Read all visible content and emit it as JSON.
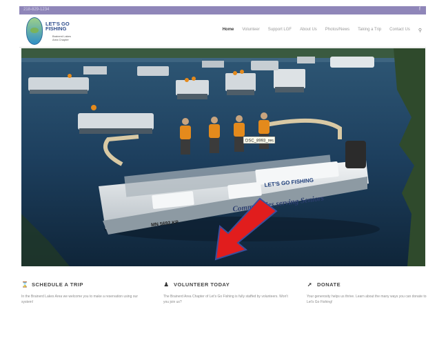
{
  "topbar": {
    "phone": "218-829-1234",
    "social_icon": "facebook-icon"
  },
  "logo": {
    "line1": "LET'S GO",
    "line2": "FISHING",
    "line3": "Brainerd Lakes",
    "line4": "Area Chapter"
  },
  "nav": {
    "items": [
      {
        "label": "Home",
        "active": true
      },
      {
        "label": "Volunteer"
      },
      {
        "label": "Support LGF"
      },
      {
        "label": "About Us"
      },
      {
        "label": "Photos/News"
      },
      {
        "label": "Taking a Trip"
      },
      {
        "label": "Contact Us"
      }
    ],
    "search_icon": "search-icon"
  },
  "hero": {
    "tooltip": "DSC_8993_res",
    "boat_banner": "Communities serving Seniors",
    "boat_brand": "LET'S GO FISHING",
    "boat_reg": "MN 5692 KP",
    "colors": {
      "water": "#1d3f5e",
      "boat_white": "#e9ecee",
      "vest": "#e48a1c",
      "arrow": "#e11d1d"
    }
  },
  "features": [
    {
      "icon": "hourglass-icon",
      "title": "SCHEDULE A TRIP",
      "body": "In the Brainerd Lakes Area we welcome you to make a reservation using our system!"
    },
    {
      "icon": "add-user-icon",
      "title": "VOLUNTEER TODAY",
      "body": "The Brainerd Area Chapter of Let's Go Fishing is fully staffed by volunteers.  Won't you join us?"
    },
    {
      "icon": "share-arrow-icon",
      "title": "DONATE",
      "body": "Your generosity helps us thrive.  Learn about the many ways you can donate to Let's Go Fishing!"
    }
  ]
}
